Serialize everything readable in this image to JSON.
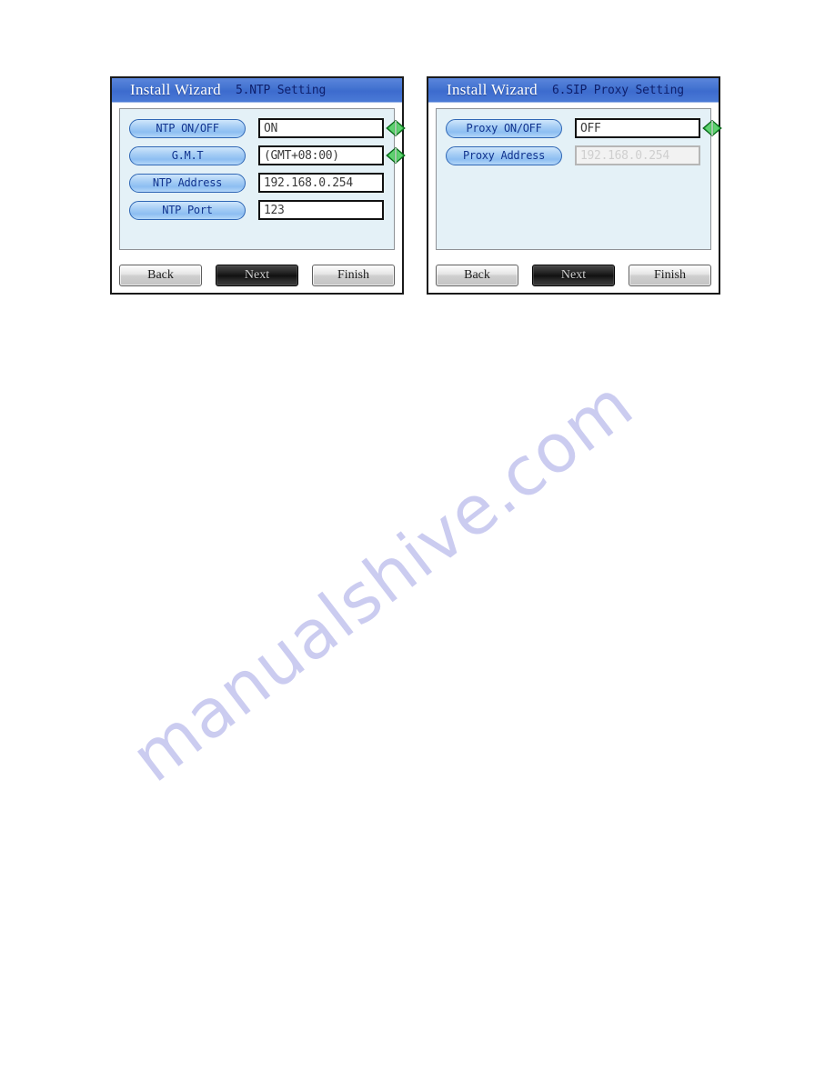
{
  "watermark": {
    "text": "manualshive.com"
  },
  "windows": [
    {
      "id": "ntp",
      "title": {
        "app": "Install Wizard",
        "step": "5.NTP Setting"
      },
      "rows": [
        {
          "label": "NTP ON/OFF",
          "value": "ON",
          "spinner": true,
          "disabled": false
        },
        {
          "label": "G.M.T",
          "value": "(GMT+08:00)",
          "spinner": true,
          "disabled": false
        },
        {
          "label": "NTP Address",
          "value": "192.168.0.254",
          "spinner": false,
          "disabled": false
        },
        {
          "label": "NTP Port",
          "value": "123",
          "spinner": false,
          "disabled": false
        }
      ],
      "buttons": [
        {
          "label": "Back",
          "focused": false
        },
        {
          "label": "Next",
          "focused": true
        },
        {
          "label": "Finish",
          "focused": false
        }
      ]
    },
    {
      "id": "proxy",
      "title": {
        "app": "Install Wizard",
        "step": "6.SIP Proxy Setting"
      },
      "rows": [
        {
          "label": "Proxy ON/OFF",
          "value": "OFF",
          "spinner": true,
          "disabled": false
        },
        {
          "label": "Proxy Address",
          "value": "192.168.0.254",
          "spinner": false,
          "disabled": true
        }
      ],
      "buttons": [
        {
          "label": "Back",
          "focused": false
        },
        {
          "label": "Next",
          "focused": true
        },
        {
          "label": "Finish",
          "focused": false
        }
      ]
    }
  ],
  "colors": {
    "titlebar_blue": "#4272d0",
    "pill_blue": "#a6cdf5",
    "pill_text": "#11348f",
    "panel_bg": "#e4f1f7",
    "spinner_green": "#19a832",
    "watermark": "#c9caf0"
  },
  "icons": {
    "spinner": "left-right-arrow-icon"
  }
}
